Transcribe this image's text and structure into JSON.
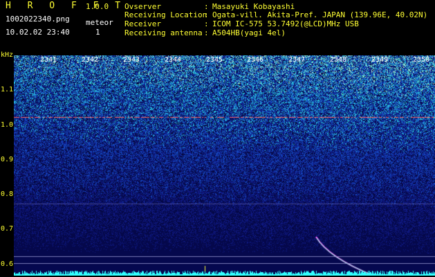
{
  "header": {
    "title": "H R O F F T",
    "version": "1.0.0",
    "filename": "1002022340.png",
    "datetime": "10.02.02 23:40",
    "meteor_label": "meteor",
    "meteor_count": "1"
  },
  "info": {
    "observer_label": "Ovserver",
    "observer_value": "Masayuki Kobayashi",
    "location_label": "Receiving Location",
    "location_value": "Ogata-vill. Akita-Pref. JAPAN (139.96E, 40.02N)",
    "receiver_label": "Receiver",
    "receiver_value": "ICOM IC-575 53.7492(@LCD)MHz USB",
    "antenna_label": "Receiving antenna",
    "antenna_value": "A504HB(yagi 4el)",
    "separator": ":"
  },
  "axis": {
    "y_unit": "kHz",
    "y_labels": [
      "1.1",
      "1.0",
      "0.9",
      "0.8",
      "0.7",
      "0.6"
    ],
    "x_labels": [
      "2341",
      "2342",
      "2343",
      "2344",
      "2345",
      "2346",
      "2347",
      "2348",
      "2349",
      "2350"
    ]
  },
  "colors": {
    "label": "#ffff33",
    "text": "#ffffff",
    "background": "#000000",
    "noise_low": "#1a1a8a",
    "noise_high": "#33ffcc",
    "carrier_line": "#ff6666",
    "meteor_trace": "#ff66ff"
  }
}
